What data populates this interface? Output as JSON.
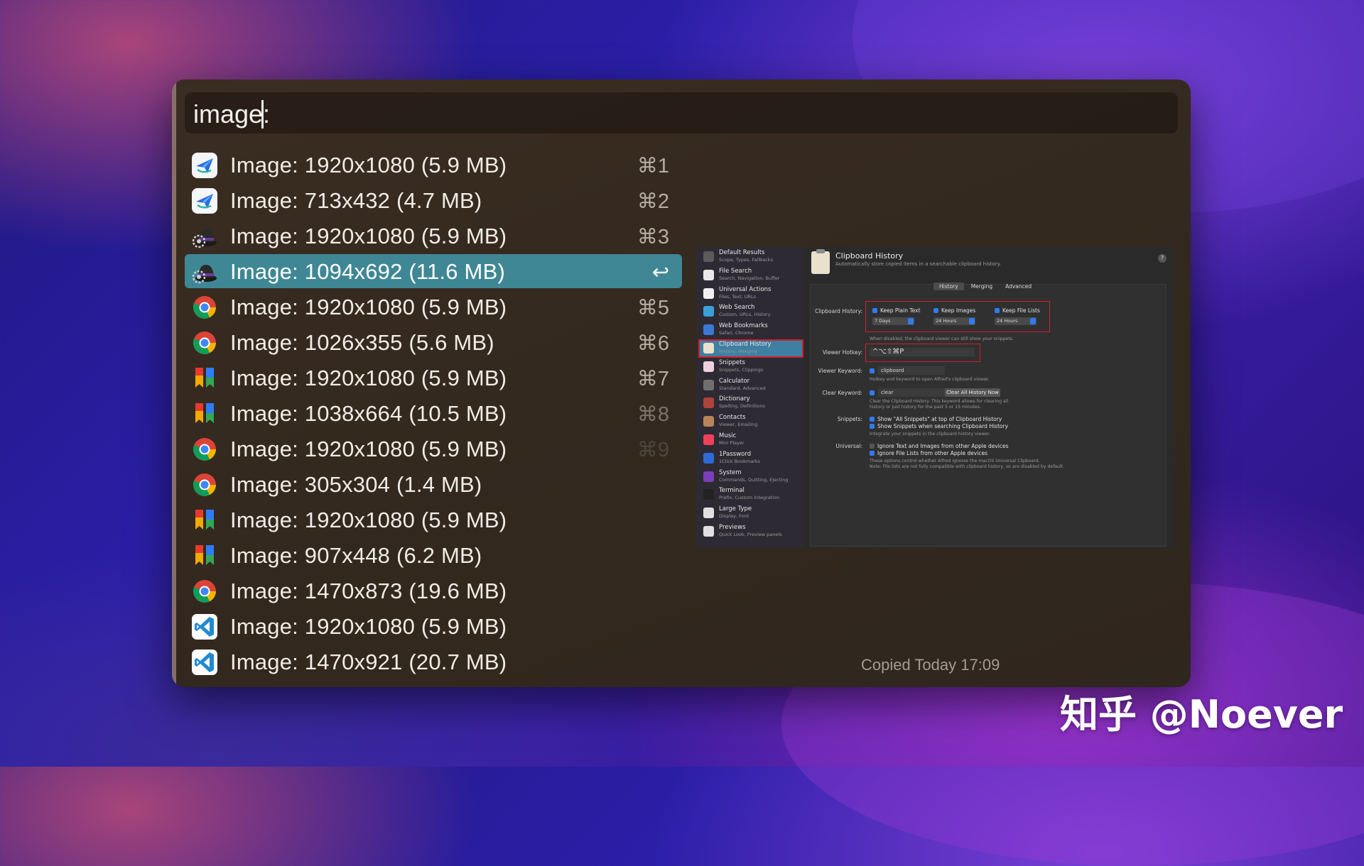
{
  "search": {
    "query": "image:"
  },
  "results": [
    {
      "label": "Image: 1920x1080 (5.9 MB)",
      "shortcut": "⌘1",
      "icon": "paper-plane-icon"
    },
    {
      "label": "Image: 713x432 (4.7 MB)",
      "shortcut": "⌘2",
      "icon": "paper-plane-icon"
    },
    {
      "label": "Image: 1920x1080 (5.9 MB)",
      "shortcut": "⌘3",
      "icon": "alfred-hat-icon"
    },
    {
      "label": "Image: 1094x692 (11.6 MB)",
      "shortcut": "↩",
      "icon": "alfred-hat-icon",
      "selected": true
    },
    {
      "label": "Image: 1920x1080 (5.9 MB)",
      "shortcut": "⌘5",
      "icon": "chrome-icon"
    },
    {
      "label": "Image: 1026x355 (5.6 MB)",
      "shortcut": "⌘6",
      "icon": "chrome-icon"
    },
    {
      "label": "Image: 1920x1080 (5.9 MB)",
      "shortcut": "⌘7",
      "icon": "bookmark-app-icon"
    },
    {
      "label": "Image: 1038x664 (10.5 MB)",
      "shortcut": "⌘8",
      "icon": "bookmark-app-icon"
    },
    {
      "label": "Image: 1920x1080 (5.9 MB)",
      "shortcut": "⌘9",
      "icon": "chrome-icon"
    },
    {
      "label": "Image: 305x304 (1.4 MB)",
      "shortcut": "",
      "icon": "chrome-icon"
    },
    {
      "label": "Image: 1920x1080 (5.9 MB)",
      "shortcut": "",
      "icon": "bookmark-app-icon"
    },
    {
      "label": "Image: 907x448 (6.2 MB)",
      "shortcut": "",
      "icon": "bookmark-app-icon"
    },
    {
      "label": "Image: 1470x873 (19.6 MB)",
      "shortcut": "",
      "icon": "chrome-icon"
    },
    {
      "label": "Image: 1920x1080 (5.9 MB)",
      "shortcut": "",
      "icon": "vscode-icon"
    },
    {
      "label": "Image: 1470x921 (20.7 MB)",
      "shortcut": "",
      "icon": "vscode-icon"
    }
  ],
  "preview": {
    "sidebar": [
      {
        "title": "Default Results",
        "sub": "Scope, Types, Fallbacks",
        "color": "#5b5b5b"
      },
      {
        "title": "File Search",
        "sub": "Search, Navigation, Buffer",
        "color": "#e8e8e8"
      },
      {
        "title": "Universal Actions",
        "sub": "Files, Text, URLs",
        "color": "#f0f0f0"
      },
      {
        "title": "Web Search",
        "sub": "Custom, URLs, History",
        "color": "#3aa0d8"
      },
      {
        "title": "Web Bookmarks",
        "sub": "Safari, Chrome",
        "color": "#3a78d8"
      },
      {
        "title": "Clipboard History",
        "sub": "History, Merging",
        "color": "#e9e1cc",
        "selected": true
      },
      {
        "title": "Snippets",
        "sub": "Snippets, Clippings",
        "color": "#f0d0e0"
      },
      {
        "title": "Calculator",
        "sub": "Standard, Advanced",
        "color": "#707070"
      },
      {
        "title": "Dictionary",
        "sub": "Spelling, Definitions",
        "color": "#b0443a"
      },
      {
        "title": "Contacts",
        "sub": "Viewer, Emailing",
        "color": "#b8855a"
      },
      {
        "title": "Music",
        "sub": "Mini Player",
        "color": "#f0405a"
      },
      {
        "title": "1Password",
        "sub": "1Click Bookmarks",
        "color": "#2f6bd8"
      },
      {
        "title": "System",
        "sub": "Commands, Quitting, Ejecting",
        "color": "#7a3fb8"
      },
      {
        "title": "Terminal",
        "sub": "Prefix, Custom Integration",
        "color": "#222222"
      },
      {
        "title": "Large Type",
        "sub": "Display, Font",
        "color": "#e0e0e0"
      },
      {
        "title": "Previews",
        "sub": "Quick Look, Preview panels",
        "color": "#e0e0e0"
      }
    ],
    "title": "Clipboard History",
    "subtitle": "Automatically store copied items in a searchable clipboard history.",
    "help": "?",
    "tabs": [
      "History",
      "Merging",
      "Advanced"
    ],
    "history_label": "Clipboard History:",
    "keep": [
      {
        "label": "Keep Plain Text",
        "value": "7 Days"
      },
      {
        "label": "Keep Images",
        "value": "24 Hours"
      },
      {
        "label": "Keep File Lists",
        "value": "24 Hours"
      }
    ],
    "disabled_note": "When disabled, the clipboard viewer can still show your snippets.",
    "hotkey_label": "Viewer Hotkey:",
    "hotkey_value": "^⌥⇧⌘P",
    "viewer_keyword_label": "Viewer Keyword:",
    "viewer_keyword": "clipboard",
    "viewer_keyword_note": "Hotkey and keyword to open Alfred's clipboard viewer.",
    "clear_keyword_label": "Clear Keyword:",
    "clear_keyword": "clear",
    "clear_button": "Clear All History Now",
    "clear_note_1": "Clear the Clipboard History. This keyword allows for clearing all",
    "clear_note_2": "history or just history for the past 5 or 15 minutes.",
    "snippets_label": "Snippets:",
    "snippets_opt1": "Show \"All Snippets\" at top of Clipboard History",
    "snippets_opt2": "Show Snippets when searching Clipboard History",
    "snippets_note": "Integrate your snippets in the clipboard history viewer.",
    "universal_label": "Universal:",
    "universal_opt1": "Ignore Text and Images from other Apple devices",
    "universal_opt2": "Ignore File Lists from other Apple devices",
    "universal_note_1": "These options control whether Alfred ignores the macOS Universal Clipboard.",
    "universal_note_2": "Note: File lists are not fully compatible with clipboard history, so are disabled by default."
  },
  "copied": "Copied Today 17:09",
  "watermark": "知乎 @Noever"
}
